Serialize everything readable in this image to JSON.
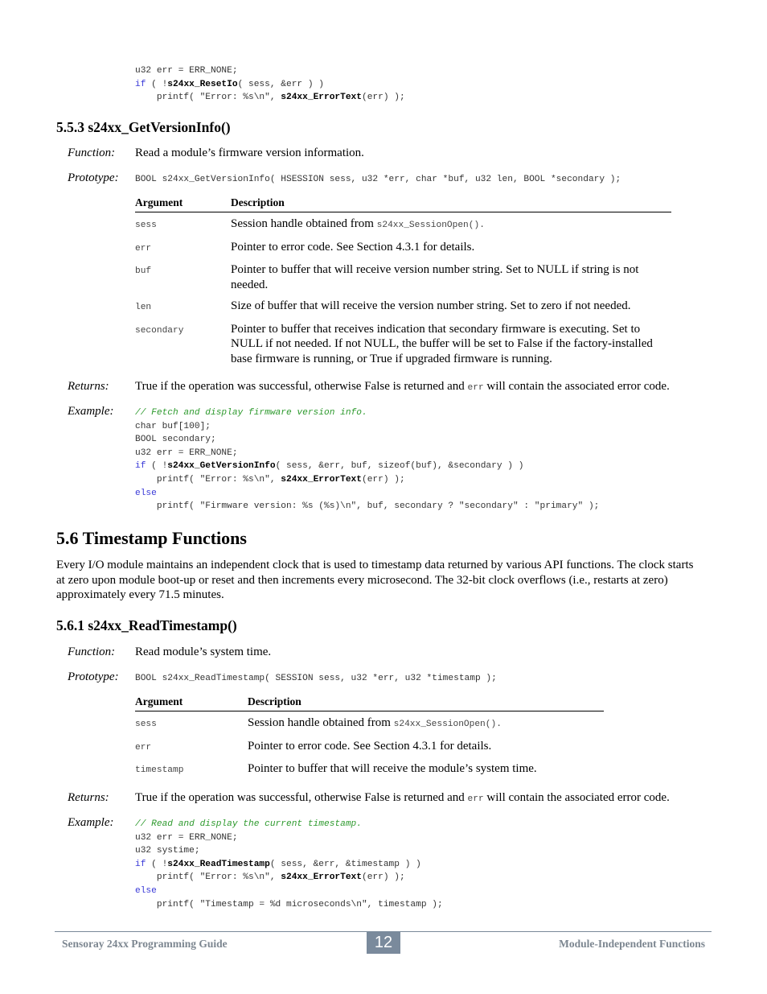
{
  "top_code": {
    "line1": "u32 err = ERR_NONE;",
    "line2_kw": "if",
    "line2_a": " ( !",
    "line2_fn": "s24xx_ResetIo",
    "line2_b": "( sess, &err ) )",
    "line3_a": "    printf( \"Error: %s\\n\", ",
    "line3_fn": "s24xx_ErrorText",
    "line3_b": "(err) );"
  },
  "section_553": {
    "heading": "5.5.3  s24xx_GetVersionInfo()",
    "function_label": "Function:",
    "function_text": "Read a module’s firmware version information.",
    "prototype_label": "Prototype:",
    "prototype": "BOOL s24xx_GetVersionInfo( HSESSION sess, u32 *err, char *buf, u32 len, BOOL *secondary );",
    "table_headers": [
      "Argument",
      "Description"
    ],
    "args": [
      {
        "name": "sess",
        "desc": "Session handle obtained from ",
        "desc_code": "s24xx_SessionOpen().",
        "desc_after": ""
      },
      {
        "name": "err",
        "desc": "Pointer to error code. See Section 4.3.1 for details.",
        "desc_code": "",
        "desc_after": ""
      },
      {
        "name": "buf",
        "desc": "Pointer to buffer that will receive version number string. Set to NULL if string is not needed.",
        "desc_code": "",
        "desc_after": ""
      },
      {
        "name": "len",
        "desc": "Size of buffer that will receive the version number string. Set to zero if not needed.",
        "desc_code": "",
        "desc_after": ""
      },
      {
        "name": "secondary",
        "desc": "Pointer to buffer that receives indication that secondary firmware is executing. Set to NULL if not needed. If not NULL, the buffer will be set to False if the factory-installed base firmware is running, or True if upgraded firmware is running.",
        "desc_code": "",
        "desc_after": ""
      }
    ],
    "returns_label": "Returns:",
    "returns_a": "True if the operation was successful, otherwise False is returned and ",
    "returns_code": "err",
    "returns_b": " will contain the associated error code.",
    "example_label": "Example:",
    "example": {
      "comment": "// Fetch and display firmware version info.",
      "l1": "char buf[100];",
      "l2": "BOOL secondary;",
      "l3": "u32 err = ERR_NONE;",
      "l4_kw": "if",
      "l4_a": " ( !",
      "l4_fn": "s24xx_GetVersionInfo",
      "l4_b": "( sess, &err, buf, sizeof(buf), &secondary ) )",
      "l5_a": "    printf( \"Error: %s\\n\", ",
      "l5_fn": "s24xx_ErrorText",
      "l5_b": "(err) );",
      "l6_kw": "else",
      "l7": "    printf( \"Firmware version: %s (%s)\\n\", buf, secondary ? \"secondary\" : \"primary\" );"
    }
  },
  "section_56": {
    "heading": "5.6  Timestamp Functions",
    "paragraph": "Every I/O module maintains an independent clock that is used to timestamp data returned by various API functions. The clock starts at zero upon module boot-up or reset and then increments every microsecond. The 32-bit clock overflows (i.e., restarts at zero) approximately every 71.5 minutes."
  },
  "section_561": {
    "heading": "5.6.1  s24xx_ReadTimestamp()",
    "function_label": "Function:",
    "function_text": "Read module’s system time.",
    "prototype_label": "Prototype:",
    "prototype": "BOOL s24xx_ReadTimestamp( SESSION sess, u32 *err, u32 *timestamp );",
    "table_headers": [
      "Argument",
      "Description"
    ],
    "args": [
      {
        "name": "sess",
        "desc": "Session handle obtained from ",
        "desc_code": "s24xx_SessionOpen()."
      },
      {
        "name": "err",
        "desc": "Pointer to error code. See Section 4.3.1 for details.",
        "desc_code": ""
      },
      {
        "name": "timestamp",
        "desc": "Pointer to buffer that will receive the module’s system time.",
        "desc_code": ""
      }
    ],
    "returns_label": "Returns:",
    "returns_a": "True if the operation was successful, otherwise False is returned and ",
    "returns_code": "err",
    "returns_b": " will contain the associated error code.",
    "example_label": "Example:",
    "example": {
      "comment": "// Read and display the current timestamp.",
      "l1": "u32 err = ERR_NONE;",
      "l2": "u32 systime;",
      "l3_kw": "if",
      "l3_a": " ( !",
      "l3_fn": "s24xx_ReadTimestamp",
      "l3_b": "( sess, &err, &timestamp ) )",
      "l4_a": "    printf( \"Error: %s\\n\", ",
      "l4_fn": "s24xx_ErrorText",
      "l4_b": "(err) );",
      "l5_kw": "else",
      "l6": "    printf( \"Timestamp = %d microseconds\\n\", timestamp );"
    }
  },
  "footer": {
    "left": "Sensoray 24xx Programming Guide",
    "page_number": "12",
    "right": "Module-Independent Functions"
  }
}
